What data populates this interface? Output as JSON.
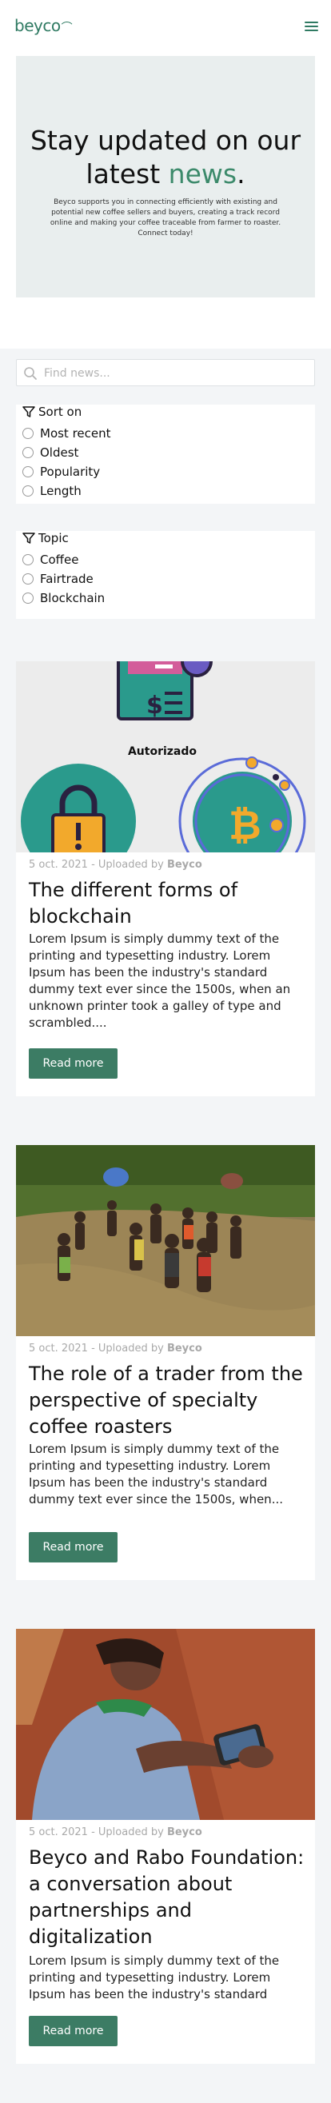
{
  "header": {
    "logo": "beyco",
    "menu_icon": "hamburger-icon"
  },
  "hero": {
    "title_line1": "Stay updated on our",
    "title_pre": "latest ",
    "title_accent": "news",
    "title_post": ".",
    "text": "Beyco supports you in connecting efficiently with existing and potential new coffee sellers and buyers, creating a track record online and making your coffee traceable from farmer to roaster. Connect today!"
  },
  "search": {
    "placeholder": "Find news...",
    "value": "",
    "icon": "search-icon"
  },
  "sort": {
    "title": "Sort on",
    "options": [
      "Most recent",
      "Oldest",
      "Popularity",
      "Length"
    ]
  },
  "topic": {
    "title": "Topic",
    "options": [
      "Coffee",
      "Fairtrade",
      "Blockchain"
    ]
  },
  "articles": [
    {
      "date": "5 oct. 2021 - Uploaded by",
      "author": "Beyco",
      "title": "The different forms of blockchain",
      "excerpt": "Lorem Ipsum is simply dummy text of the printing and typesetting industry. Lorem Ipsum has been the industry's standard dummy text ever since the 1500s, when an unknown printer took a galley of type and scrambled....",
      "button": "Read more",
      "image_text": "Autorizado"
    },
    {
      "date": "5 oct. 2021 - Uploaded by",
      "author": "Beyco",
      "title": "The role of a trader from the perspective of specialty coffee roasters",
      "excerpt": "Lorem Ipsum is simply dummy text of the printing and typesetting industry. Lorem Ipsum has been the industry's standard dummy text ever since the 1500s, when...",
      "button": "Read more"
    },
    {
      "date": "5 oct. 2021 - Uploaded by",
      "author": "Beyco",
      "title": "Beyco and Rabo Foundation: a conversation about partnerships and digitalization",
      "excerpt": "Lorem Ipsum is simply dummy text of the printing and typesetting industry. Lorem Ipsum has been the industry's standard",
      "button": "Read more"
    }
  ],
  "colors": {
    "brand": "#3c7c64",
    "accent": "#3c8a6b",
    "page_bg": "#f3f5f7"
  }
}
